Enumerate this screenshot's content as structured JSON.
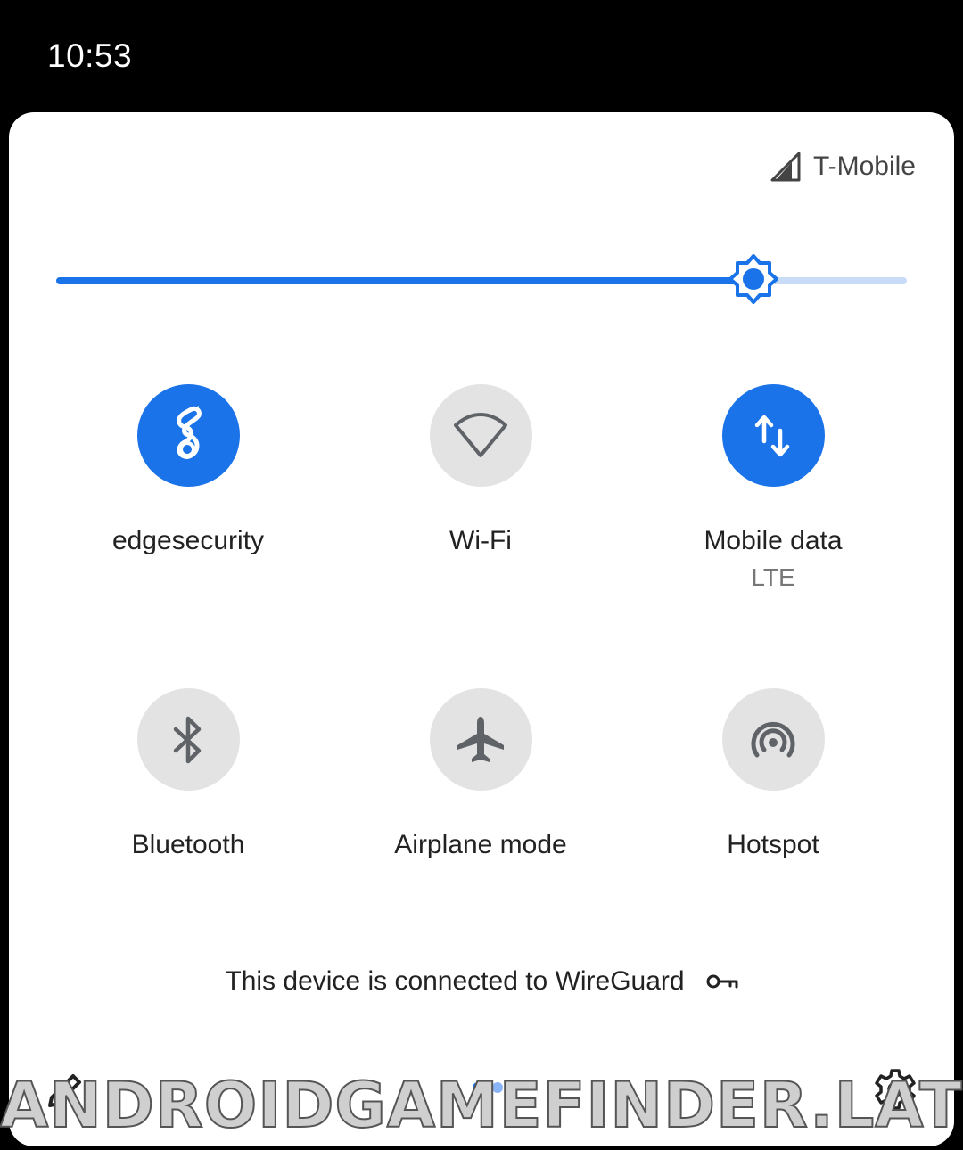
{
  "status_bar": {
    "time": "10:53"
  },
  "carrier": {
    "name": "T-Mobile",
    "icon": "signal-icon"
  },
  "brightness": {
    "level": 0.82,
    "accent": "#1a73e8",
    "track": "#c8dcf8",
    "icon": "brightness-icon"
  },
  "tiles": [
    {
      "label": "edgesecurity",
      "state": "on",
      "icon": "wireguard-icon"
    },
    {
      "label": "Wi-Fi",
      "state": "off",
      "icon": "wifi-icon"
    },
    {
      "label": "Mobile data",
      "sublabel": "LTE",
      "state": "on",
      "icon": "mobile-data-icon"
    },
    {
      "label": "Bluetooth",
      "state": "off",
      "icon": "bluetooth-icon"
    },
    {
      "label": "Airplane mode",
      "state": "off",
      "icon": "airplane-icon"
    },
    {
      "label": "Hotspot",
      "state": "off",
      "icon": "hotspot-icon"
    }
  ],
  "vpn_notice": {
    "text": "This device is connected to WireGuard",
    "icon": "key-icon"
  },
  "footer": {
    "edit_icon": "edit-icon",
    "settings_icon": "settings-icon",
    "page_count": 2
  },
  "watermark": "ANDROIDGAMEFINDER.LAT",
  "colors": {
    "active": "#1a73e8",
    "inactive": "#e3e3e3",
    "panel": "#ffffff",
    "background": "#000000"
  }
}
